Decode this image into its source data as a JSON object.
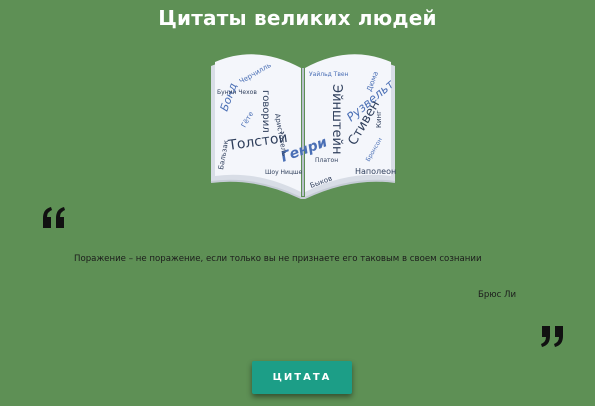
{
  "page": {
    "title": "Цитаты великих людей"
  },
  "illustration": {
    "icon": "book-word-cloud-icon",
    "words": [
      "Толстой",
      "Стивен",
      "Эйнштейн",
      "Рузвельт",
      "Генри",
      "говорил",
      "Бонд",
      "Наполеон",
      "Аристотель",
      "Быков",
      "Бронсон",
      "Дюма",
      "Кинг",
      "Черчилль",
      "Гёте",
      "Бальзак"
    ]
  },
  "quote": {
    "text": "Поражение – не поражение, если только вы не признаете его таковым в своем сознании",
    "author": "Брюс Ли",
    "open_icon": "open-quote-icon",
    "close_icon": "close-quote-icon"
  },
  "actions": {
    "button_label": "ЦИТАТА"
  },
  "colors": {
    "background": "#5e9055",
    "button": "#1c9e87",
    "text": "#1c1c1c",
    "title": "#ffffff",
    "cloud_dark": "#2f3f5c",
    "cloud_blue": "#4a6fb5"
  }
}
